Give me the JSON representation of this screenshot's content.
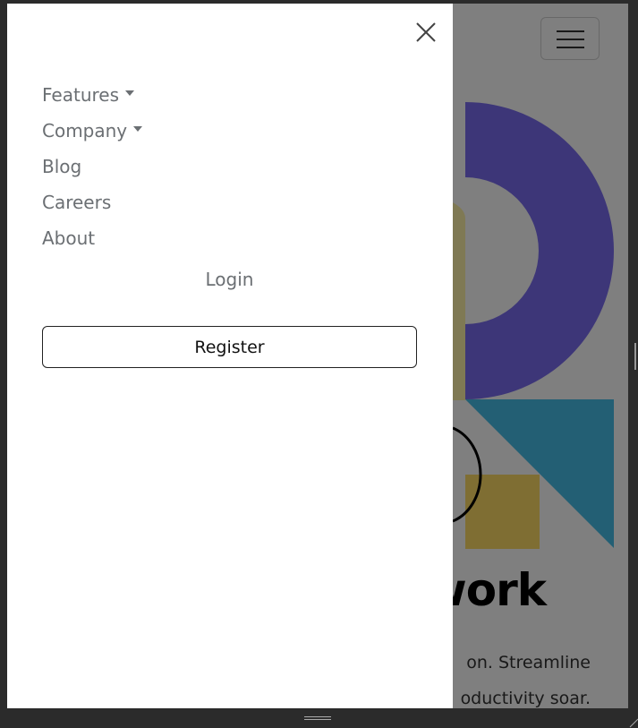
{
  "header": {
    "menu_toggle_label": "Toggle navigation"
  },
  "hero": {
    "title_visible": "work",
    "text_lines": [
      "on. Streamline",
      "oductivity soar."
    ]
  },
  "drawer": {
    "close_label": "Close",
    "nav": [
      {
        "label": "Features",
        "dropdown": true
      },
      {
        "label": "Company",
        "dropdown": true
      },
      {
        "label": "Blog",
        "dropdown": false
      },
      {
        "label": "Careers",
        "dropdown": false
      },
      {
        "label": "About",
        "dropdown": false
      }
    ],
    "login_label": "Login",
    "register_label": "Register"
  },
  "colors": {
    "scrim": "rgba(0,0,0,0.5)",
    "shape_purple": "#3c3678",
    "shape_olive": "#7f7120",
    "shape_teal": "#235e74",
    "shape_mustard": "#7f6d33",
    "nav_text": "#6b6f73"
  }
}
